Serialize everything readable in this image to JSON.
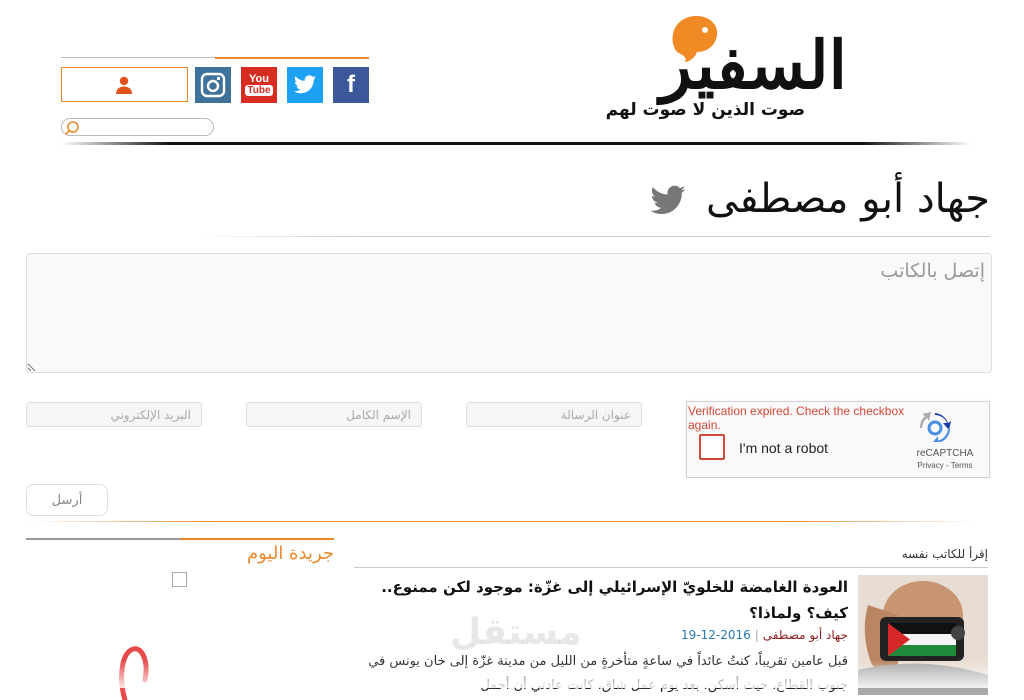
{
  "header": {
    "logo_main": "السفير",
    "logo_sub": "صوت الذين لا صوت لهم",
    "social": [
      {
        "name": "facebook-icon",
        "glyph": "f",
        "color": "#3b5998"
      },
      {
        "name": "twitter-icon",
        "glyph": "🐦",
        "color": "#1da1f2"
      },
      {
        "name": "youtube-icon",
        "glyph": "You Tube",
        "color": "#e52d27"
      },
      {
        "name": "instagram-icon",
        "glyph": "◎",
        "color": "#3f729b"
      }
    ],
    "search_placeholder": ""
  },
  "author": {
    "name": "جهاد أبو مصطفى"
  },
  "contact_form": {
    "message_placeholder": "إتصل بالكاتب",
    "subject_placeholder": "عنوان الرسالة",
    "name_placeholder": "الإسم الكامل",
    "email_placeholder": "البريد الإلكتروني",
    "send_label": "أرسل"
  },
  "recaptcha": {
    "error": "Verification expired. Check the checkbox again.",
    "label": "I'm not a robot",
    "brand": "reCAPTCHA",
    "links": "Privacy - Terms"
  },
  "sidebar": {
    "title": "جريدة اليوم"
  },
  "articles_section": {
    "heading": "إقرأ للكاتب نفسه",
    "article": {
      "title": "العودة الغامضة للخلويّ الإسرائيلي إلى غزّة: موجود لكن ممنوع.. كيف؟ ولماذا؟",
      "author": "جهاد أبو مصطفى",
      "date": "2016-12-19",
      "separator": "|",
      "excerpt": "قبل عامين تقريباً، كنتُ عائداً في ساعةٍ متأخرةٍ من الليل من مدينة غزّة إلى خان يونس في جنوب القطاع، حيث أسكن. بعد يوم عمل شاق، كانت عادتي أن أحمل"
    }
  },
  "watermark": "مستقل",
  "colors": {
    "accent": "#e8892c",
    "author_link": "#8b1d1d",
    "date": "#2a7ab0",
    "error": "#d14836"
  }
}
